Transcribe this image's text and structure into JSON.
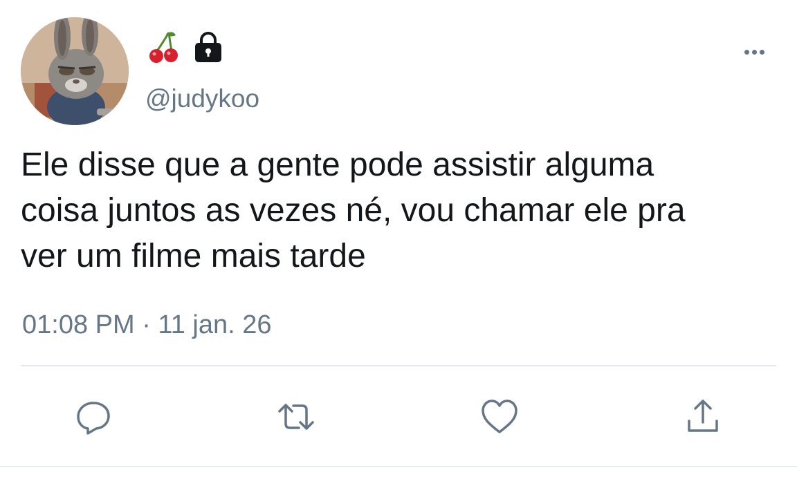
{
  "tweet": {
    "handle": "@judykoo",
    "text": "Ele disse que a gente pode assistir alguma\ncoisa juntos as vezes né, vou chamar ele pra\nver um filme mais tarde",
    "timestamp": "01:08 PM · 11 jan. 26"
  },
  "icons": {
    "name_emoji": [
      "cherry-icon",
      "lock-icon"
    ],
    "more": "more-options-icon",
    "actions": [
      "reply-icon",
      "retweet-icon",
      "like-icon",
      "share-icon"
    ]
  },
  "colors": {
    "text": "#14171a",
    "secondary": "#657786",
    "divider": "#e1e8ed",
    "cherry": "#d6202e",
    "stem": "#4f8a2b"
  }
}
